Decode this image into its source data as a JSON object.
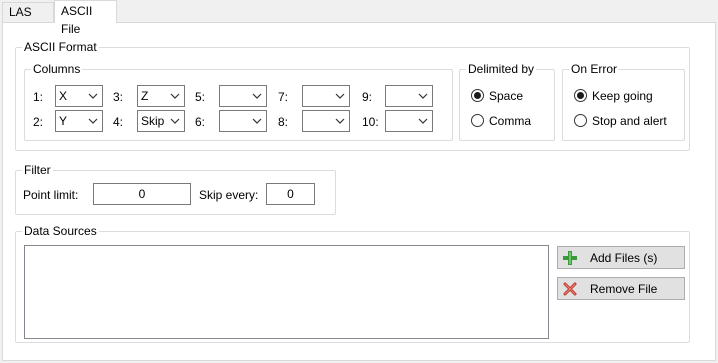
{
  "tabs": [
    {
      "label": "LAS File",
      "active": false
    },
    {
      "label": "ASCII File",
      "active": true
    }
  ],
  "ascii_format": {
    "title": "ASCII Format",
    "columns": {
      "title": "Columns",
      "items": [
        {
          "label": "1:",
          "value": "X"
        },
        {
          "label": "2:",
          "value": "Y"
        },
        {
          "label": "3:",
          "value": "Z"
        },
        {
          "label": "4:",
          "value": "Skip"
        },
        {
          "label": "5:",
          "value": ""
        },
        {
          "label": "6:",
          "value": ""
        },
        {
          "label": "7:",
          "value": ""
        },
        {
          "label": "8:",
          "value": ""
        },
        {
          "label": "9:",
          "value": ""
        },
        {
          "label": "10:",
          "value": ""
        }
      ]
    },
    "delimited_by": {
      "title": "Delimited by",
      "options": [
        {
          "label": "Space",
          "checked": true
        },
        {
          "label": "Comma",
          "checked": false
        }
      ]
    },
    "on_error": {
      "title": "On Error",
      "options": [
        {
          "label": "Keep going",
          "checked": true
        },
        {
          "label": "Stop and alert",
          "checked": false
        }
      ]
    }
  },
  "filter": {
    "title": "Filter",
    "point_limit_label": "Point limit:",
    "point_limit_value": "0",
    "skip_every_label": "Skip every:",
    "skip_every_value": "0"
  },
  "data_sources": {
    "title": "Data Sources",
    "files": [],
    "add_button": "Add Files (s)",
    "remove_button": "Remove File"
  },
  "icons": {
    "add": "add-plus-icon",
    "remove": "remove-x-icon",
    "chevron": "chevron-down-icon"
  },
  "colors": {
    "add_icon": "#3a9a3a",
    "remove_icon": "#c0392b"
  }
}
